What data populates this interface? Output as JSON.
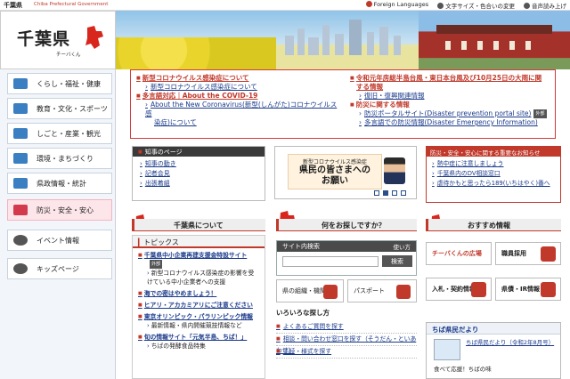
{
  "topbar": {
    "site_name": "千葉県",
    "site_name_en": "Chiba Prefectural Government",
    "foreign_languages": "Foreign Languages",
    "text_size_color": "文字サイズ・色合いの変更",
    "read_aloud": "音声読み上げ"
  },
  "logo": {
    "title": "千葉県",
    "kana": "チーバくん"
  },
  "leftnav": {
    "items": [
      {
        "label": "くらし・福祉・健康"
      },
      {
        "label": "教育・文化・スポーツ"
      },
      {
        "label": "しごと・産業・観光"
      },
      {
        "label": "環境・まちづくり"
      },
      {
        "label": "県政情報・統計"
      },
      {
        "label": "防災・安全・安心"
      },
      {
        "label": "イベント情報"
      },
      {
        "label": "キッズページ"
      }
    ]
  },
  "announce": {
    "left": {
      "h1": "新型コロナウイルス感染症について",
      "s1": "新型コロナウイルス感染症について",
      "h2": "多言語対応｜About the COVID-19",
      "s2a": "About the New Coronavirus(新型(しんがた)コロナウイルス感",
      "s2b": "染症)について"
    },
    "right": {
      "h1a": "令和元年房総半島台風・東日本台風及び10月25日の大雨に関",
      "h1b": "する情報",
      "s1": "復旧・復興関連情報",
      "h2": "防災に関する情報",
      "s2": "防災ポータルサイト(Disaster prevention portal site)",
      "s2_badge": "外部",
      "s3": "多言語での防災情報(Disaster Emergency Information)"
    }
  },
  "governor": {
    "title": "知事のページ",
    "links": [
      "知事の動き",
      "記者会見",
      "出張着組"
    ]
  },
  "slide": {
    "line1": "新型コロナウイルス感染症",
    "line2a": "県民の皆さまへの",
    "line2b": "お願い"
  },
  "safety": {
    "title": "防災・安全・安心に関する重要なお知らせ",
    "links": [
      "熱中症に注意しましょう",
      "千葉県内のDV相談窓口",
      "虐待かもと思ったら189(いちはやく)番へ"
    ]
  },
  "sections": {
    "about": "千葉県について",
    "search_for": "何をお探しですか？",
    "recommended": "おすすめ情報"
  },
  "topics": {
    "title": "トピックス",
    "items": [
      {
        "title": "千葉県中小企業再建支援金特設サイト",
        "badge": "外部",
        "sub": "新型コロナウイルス感染症の影響を受けている中小企業者への支援"
      },
      {
        "title": "海での密はやめましょう！"
      },
      {
        "title": "ヒアリ・アカカミアリにご注意ください"
      },
      {
        "title": "東京オリンピック・パラリンピック情報",
        "sub": "最新情報・県内開催競技情報など"
      },
      {
        "title": "旬の情報サイト「元気半島、ちば！」",
        "sub": "ちばの発酵食品特集"
      }
    ]
  },
  "search": {
    "title": "サイト内検索",
    "usage": "使い方",
    "placeholder": "",
    "button": "検索"
  },
  "tiles": {
    "org": "県の組織・機関",
    "passport": "パスポート"
  },
  "howto": {
    "title": "いろいろな探し方",
    "rows": [
      "よくあるご質問を探す",
      "相談・問い合わせ窓口を探す（そうだん・といあわせ）",
      "手続・様式を探す"
    ]
  },
  "recommended": {
    "koho": "チーバくんの広場",
    "recruit": "職員採用",
    "bid": "入札・契約情報",
    "pr": "県債・IR情報"
  },
  "tayori": {
    "title": "ちば県民だより",
    "link": "ちば県民だより（令和2年8月号）",
    "bottom": "食べて応援！ちばの味"
  },
  "colors": {
    "accent_red": "#c0392b",
    "link_blue": "#1a3a8a"
  }
}
